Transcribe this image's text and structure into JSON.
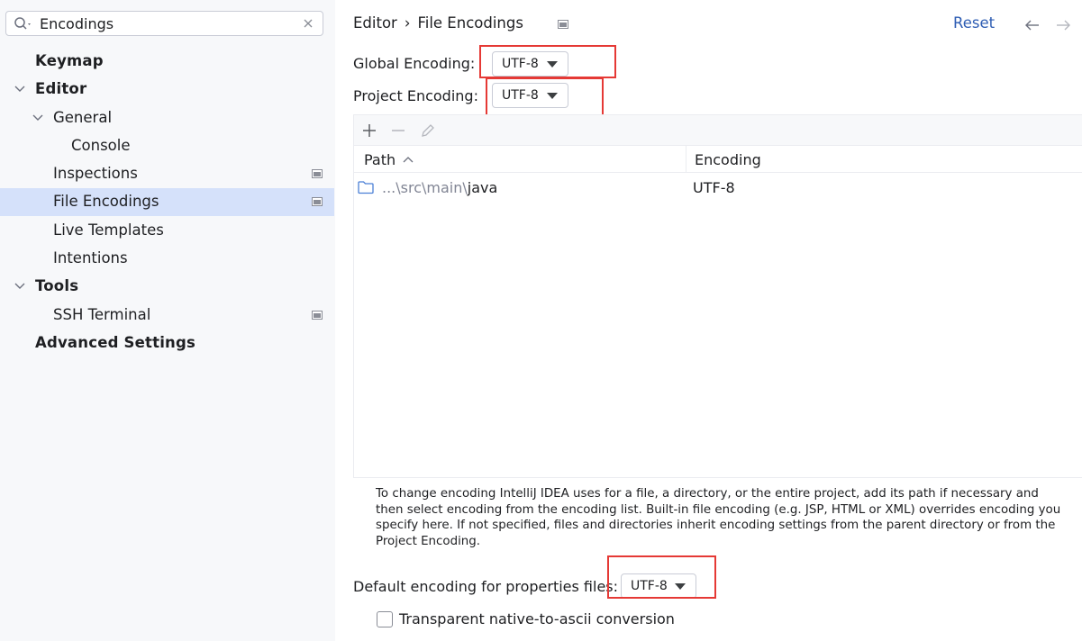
{
  "search": {
    "value": "Encodings"
  },
  "tree": {
    "keymap": "Keymap",
    "editor": "Editor",
    "general": "General",
    "console": "Console",
    "inspections": "Inspections",
    "file_encodings": "File Encodings",
    "live_templates": "Live Templates",
    "intentions": "Intentions",
    "tools": "Tools",
    "ssh_terminal": "SSH Terminal",
    "advanced_settings": "Advanced Settings"
  },
  "header": {
    "breadcrumb_parent": "Editor",
    "breadcrumb_sep": "›",
    "breadcrumb_current": "File Encodings",
    "reset": "Reset"
  },
  "encodings": {
    "global_label": "Global Encoding:",
    "global_value": "UTF-8",
    "project_label": "Project Encoding:",
    "project_value": "UTF-8"
  },
  "table": {
    "col_path": "Path",
    "col_encoding": "Encoding",
    "rows": [
      {
        "path_prefix": "...\\src\\main\\",
        "path_name": "java",
        "encoding": "UTF-8"
      }
    ]
  },
  "description": "To change encoding IntelliJ IDEA uses for a file, a directory, or the entire project, add its path if necessary and then select encoding from the encoding list. Built-in file encoding (e.g. JSP, HTML or XML) overrides encoding you specify here. If not specified, files and directories inherit encoding settings from the parent directory or from the Project Encoding.",
  "properties": {
    "label": "Default encoding for properties files:",
    "value": "UTF-8"
  },
  "native_to_ascii": {
    "label": "Transparent native-to-ascii conversion",
    "checked": false
  },
  "colors": {
    "selection": "#d5e1fa",
    "link": "#2e5db3",
    "highlight_box": "#e53935",
    "folder": "#4a7fd6"
  }
}
